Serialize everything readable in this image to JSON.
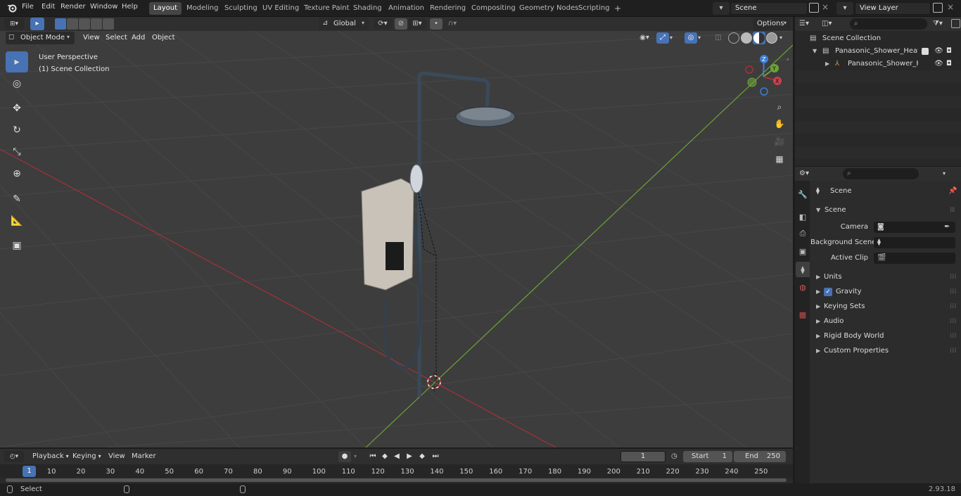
{
  "menu": {
    "file": "File",
    "edit": "Edit",
    "render": "Render",
    "window": "Window",
    "help": "Help"
  },
  "workspaces": [
    "Layout",
    "Modeling",
    "Sculpting",
    "UV Editing",
    "Texture Paint",
    "Shading",
    "Animation",
    "Rendering",
    "Compositing",
    "Geometry Nodes",
    "Scripting"
  ],
  "add_tab": "+",
  "scene_field": "Scene",
  "view_layer_field": "View Layer",
  "toolbar": {
    "transform_orientation": "Global",
    "options": "Options"
  },
  "viewport_header": {
    "mode": "Object Mode",
    "view": "View",
    "select": "Select",
    "add": "Add",
    "object": "Object"
  },
  "viewport_overlay": {
    "perspective": "User Perspective",
    "collection": "(1) Scene Collection"
  },
  "gizmo": {
    "x": "X",
    "y": "Y",
    "z": "Z"
  },
  "outliner": {
    "scene_collection": "Scene Collection",
    "item1": "Panasonic_Shower_Heater_Le",
    "item2": "Panasonic_Shower_Heate"
  },
  "properties": {
    "header": "Scene",
    "section": "Scene",
    "camera_label": "Camera",
    "bg_scene_label": "Background Scene",
    "active_clip_label": "Active Clip",
    "panels": [
      "Units",
      "Gravity",
      "Keying Sets",
      "Audio",
      "Rigid Body World",
      "Custom Properties"
    ]
  },
  "timeline": {
    "playback": "Playback",
    "keying": "Keying",
    "view": "View",
    "marker": "Marker",
    "current_frame": "1",
    "start_label": "Start",
    "start": "1",
    "end_label": "End",
    "end": "250",
    "ticks": [
      "1",
      "10",
      "20",
      "30",
      "40",
      "50",
      "60",
      "70",
      "80",
      "90",
      "100",
      "110",
      "120",
      "130",
      "140",
      "150",
      "160",
      "170",
      "180",
      "190",
      "200",
      "210",
      "220",
      "230",
      "240",
      "250"
    ]
  },
  "status": {
    "select": "Select",
    "version": "2.93.18"
  },
  "colors": {
    "accent": "#4772b3",
    "x_axis": "#a3323a",
    "y_axis": "#6da238",
    "z_axis": "#3b7fd4"
  }
}
